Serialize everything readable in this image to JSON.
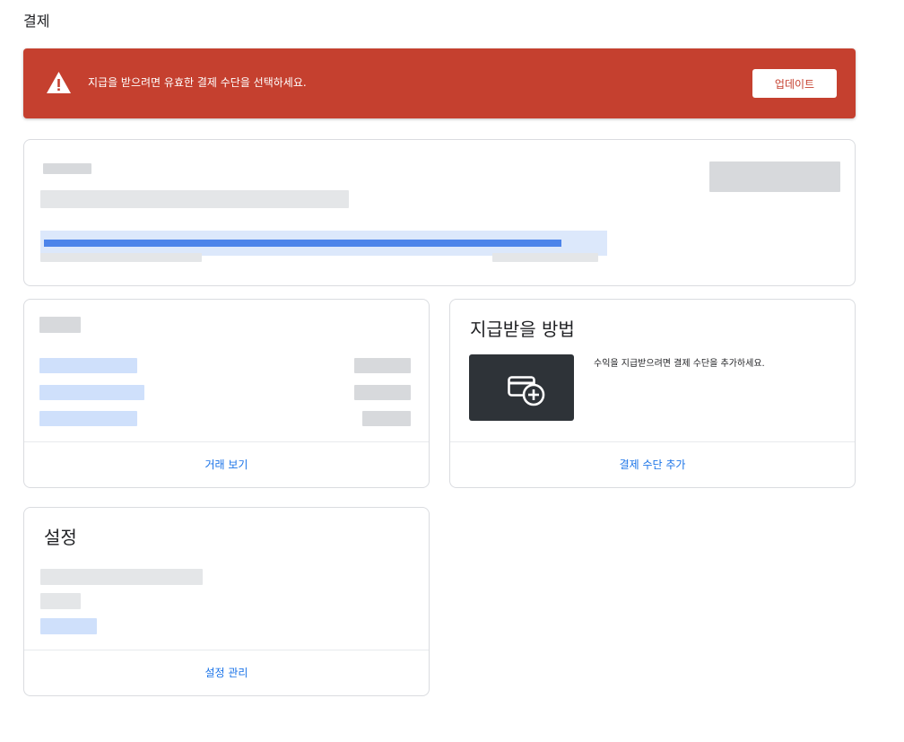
{
  "page": {
    "title": "결제"
  },
  "alert": {
    "message": "지급을 받으려면 유효한 결제 수단을 선택하세요.",
    "button_label": "업데이트",
    "icon": "warning-icon",
    "color": "#c5402f"
  },
  "earnings": {
    "progress_fraction": 0.93
  },
  "transactions": {
    "link_label": "거래 보기"
  },
  "payment_method": {
    "title": "지급받을 방법",
    "description": "수익을 지급받으려면 결제 수단을 추가하세요.",
    "link_label": "결제 수단 추가",
    "icon": "add-card-icon"
  },
  "settings": {
    "title": "설정",
    "link_label": "설정 관리"
  },
  "colors": {
    "accent": "#1a73e8",
    "progress": "#4c84ea",
    "alert": "#c5402f"
  }
}
